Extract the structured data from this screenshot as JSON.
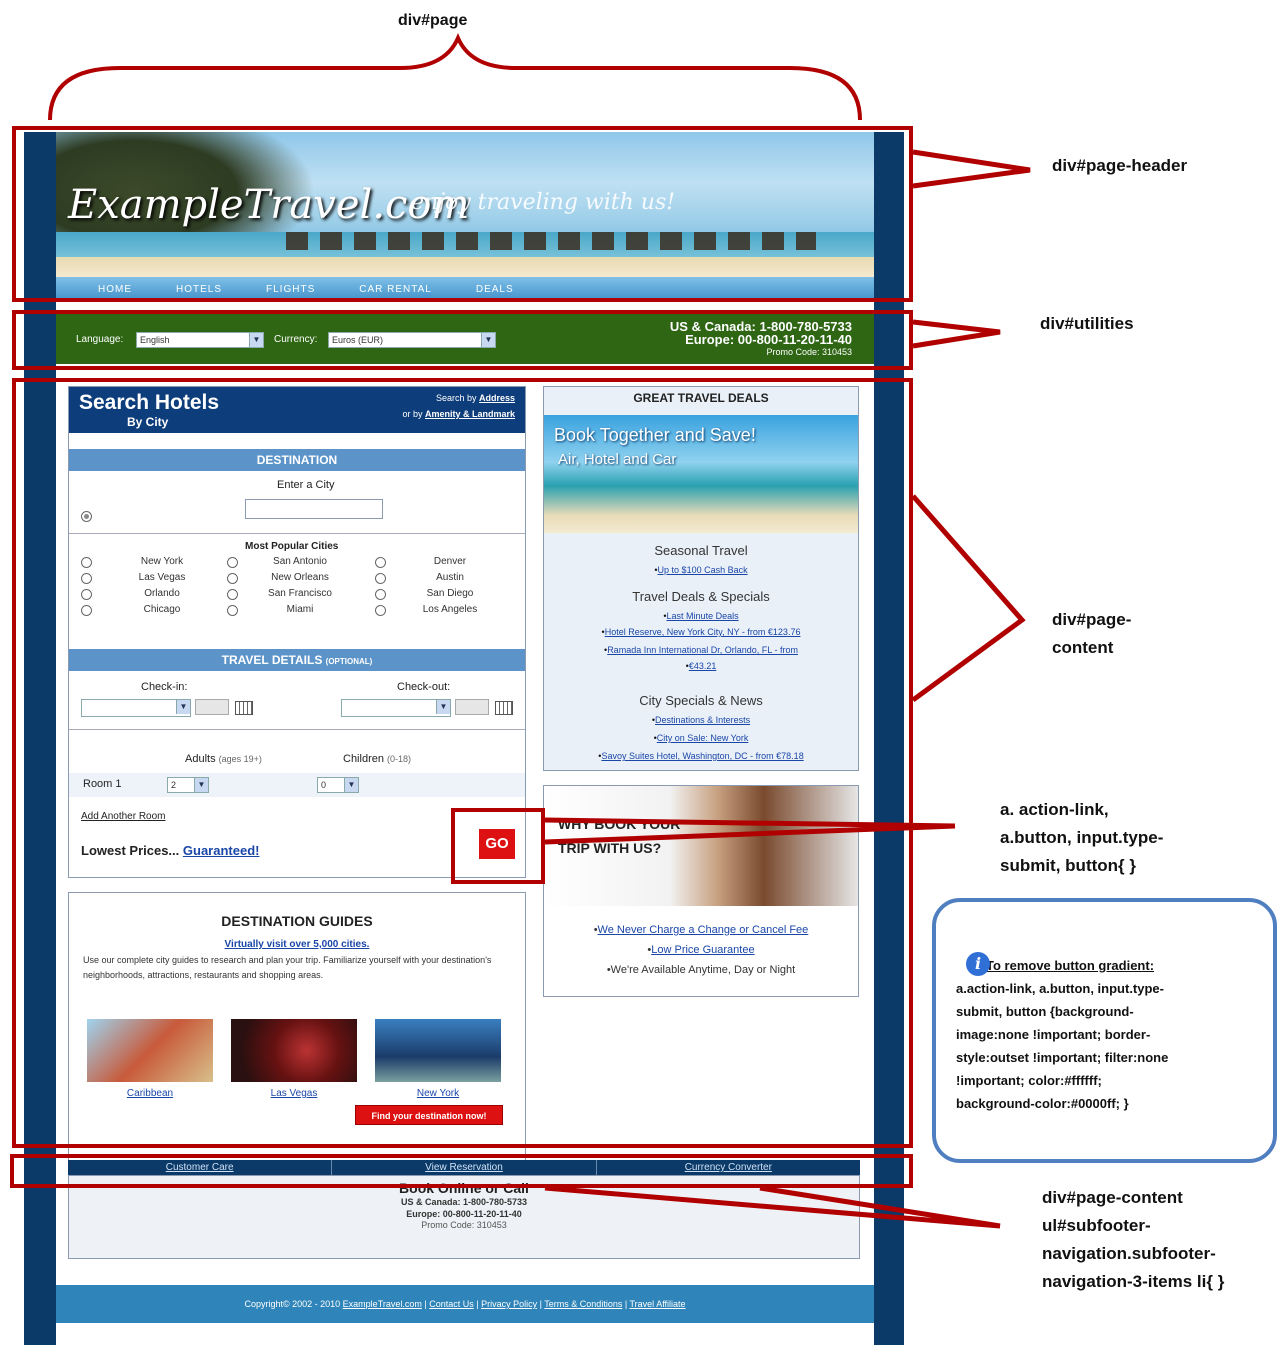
{
  "annotations": {
    "page": "div#page",
    "page_header": "div#page-header",
    "utilities": "div#utilities",
    "page_content_1": "div#page-",
    "page_content_2": "content",
    "buttons_1": "a. action-link,",
    "buttons_2": "a.button, input.type-",
    "buttons_3": "submit, button{ }",
    "subfooter_1": "div#page-content",
    "subfooter_2": "ul#subfooter-",
    "subfooter_3": "navigation.subfooter-",
    "subfooter_4": "navigation-3-items li{ }"
  },
  "note": {
    "heading": "To remove button gradient:",
    "line1": "a.action-link, a.button, input.type-",
    "line2": "submit, button {background-",
    "line3": "image:none !important; border-",
    "line4": "style:outset !important; filter:none",
    "line5": "!important; color:#ffffff;",
    "line6": "background-color:#0000ff; }"
  },
  "header": {
    "logo": "ExampleTravel.com",
    "tagline": "enjoy traveling with us!",
    "nav": [
      "HOME",
      "HOTELS",
      "FLIGHTS",
      "CAR RENTAL",
      "DEALS"
    ]
  },
  "utilities": {
    "language_label": "Language:",
    "language_value": "English",
    "currency_label": "Currency:",
    "currency_value": "Euros (EUR)",
    "phone_us": "US & Canada: 1-800-780-5733",
    "phone_eu": "Europe: 00-800-11-20-11-40",
    "promo": "Promo Code: 310453"
  },
  "search": {
    "title": "Search Hotels",
    "subtitle": "By City",
    "search_by_prefix": "Search by",
    "search_by_link": "Address",
    "or_by_prefix": "or by",
    "or_by_link": "Amenity & Landmark",
    "destination_bar": "DESTINATION",
    "enter_city_label": "Enter a City",
    "popular_label": "Most Popular Cities",
    "cities": [
      "New York",
      "San Antonio",
      "Denver",
      "Las Vegas",
      "New Orleans",
      "Austin",
      "Orlando",
      "San Francisco",
      "San Diego",
      "Chicago",
      "Miami",
      "Los Angeles"
    ],
    "travel_bar": "TRAVEL DETAILS",
    "travel_bar_small": "(OPTIONAL)",
    "checkin_label": "Check-in:",
    "checkout_label": "Check-out:",
    "adults_label": "Adults",
    "adults_hint": "(ages 19+)",
    "children_label": "Children",
    "children_hint": "(0-18)",
    "room_label": "Room 1",
    "adults_value": "2",
    "children_value": "0",
    "add_room": "Add Another Room",
    "lowest_prefix": "Lowest Prices...",
    "lowest_link": "Guaranteed!",
    "go": "GO"
  },
  "guides": {
    "title": "DESTINATION GUIDES",
    "sub": "Virtually visit over 5,000 cities.",
    "para": "Use our complete city guides to research and plan your trip. Familiarize yourself with your destination's neighborhoods, attractions, restaurants and shopping areas.",
    "places": [
      "Caribbean",
      "Las Vegas",
      "New York"
    ],
    "find_button": "Find your destination now!"
  },
  "deals": {
    "heading": "GREAT TRAVEL DEALS",
    "banner_line1": "Book Together and Save!",
    "banner_line2": "Air, Hotel and Car",
    "seasonal": "Seasonal Travel",
    "seasonal_item": "Up to $100 Cash Back",
    "specials": "Travel Deals & Specials",
    "specials_items": [
      "Last Minute Deals",
      "Hotel Reserve, New York City, NY - from €123.76",
      "Ramada Inn International Dr, Orlando, FL - from",
      "€43.21"
    ],
    "city": "City Specials & News",
    "city_items": [
      "Destinations & Interests",
      "City on Sale: New York",
      "Savoy Suites Hotel, Washington, DC - from €78.18"
    ]
  },
  "why": {
    "title_line1": "WHY BOOK YOUR",
    "title_line2": "TRIP WITH US?",
    "items": [
      "We Never Charge a Change or Cancel Fee",
      "Low Price Guarantee",
      "We're Available Anytime, Day or Night"
    ]
  },
  "subfooter": {
    "links": [
      "Customer Care",
      "View Reservation",
      "Currency Converter"
    ],
    "book_title": "Book Online or Call",
    "book_us": "US & Canada: 1-800-780-5733",
    "book_eu": "Europe: 00-800-11-20-11-40",
    "book_promo": "Promo Code: 310453"
  },
  "footer": {
    "copyright": "Copyright© 2002 - 2010",
    "links": [
      "ExampleTravel.com",
      "Contact Us",
      "Privacy Policy",
      "Terms & Conditions",
      "Travel Affiliate"
    ]
  }
}
